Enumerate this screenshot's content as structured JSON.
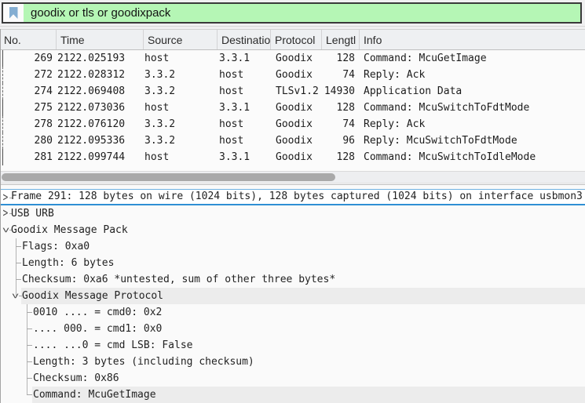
{
  "filter_bar": {
    "value": "goodix or tls or goodixpack",
    "background_color": "#b5f6b5",
    "bookmark_icon_color": "#84aed2"
  },
  "packet_list": {
    "columns": [
      "No.",
      "Time",
      "Source",
      "Destination",
      "Protocol",
      "Lengtl",
      "Info"
    ],
    "rows": [
      {
        "no": "269",
        "time": "2122.025193",
        "source": "host",
        "destination": "3.3.1",
        "protocol": "Goodix",
        "length": "128",
        "info": "Command: McuGetImage",
        "marker": "solid"
      },
      {
        "no": "272",
        "time": "2122.028312",
        "source": "3.3.2",
        "destination": "host",
        "protocol": "Goodix",
        "length": "74",
        "info": "Reply: Ack",
        "marker": "dashed"
      },
      {
        "no": "274",
        "time": "2122.069408",
        "source": "3.3.2",
        "destination": "host",
        "protocol": "TLSv1.2",
        "length": "14930",
        "info": "Application Data",
        "marker": "dashed"
      },
      {
        "no": "275",
        "time": "2122.073036",
        "source": "host",
        "destination": "3.3.1",
        "protocol": "Goodix",
        "length": "128",
        "info": "Command: McuSwitchToFdtMode",
        "marker": "solid"
      },
      {
        "no": "278",
        "time": "2122.076120",
        "source": "3.3.2",
        "destination": "host",
        "protocol": "Goodix",
        "length": "74",
        "info": "Reply: Ack",
        "marker": "dashed"
      },
      {
        "no": "280",
        "time": "2122.095336",
        "source": "3.3.2",
        "destination": "host",
        "protocol": "Goodix",
        "length": "96",
        "info": "Reply: McuSwitchToFdtMode",
        "marker": "dashed"
      },
      {
        "no": "281",
        "time": "2122.099744",
        "source": "host",
        "destination": "3.3.1",
        "protocol": "Goodix",
        "length": "128",
        "info": "Command: McuSwitchToIdleMode",
        "marker": "solid"
      }
    ]
  },
  "hscrollbar": {
    "orientation": "horizontal",
    "thumb_color": "#a9a9a9"
  },
  "packet_details": {
    "selected_border_color": "#2f8fd4",
    "shaded_row_color": "#ececec",
    "rows": [
      {
        "text": "Frame 291: 128 bytes on wire (1024 bits), 128 bytes captured (1024 bits) on interface usbmon3",
        "depth": 0,
        "expander": "collapsed",
        "selected": true
      },
      {
        "text": "USB URB",
        "depth": 0,
        "expander": "collapsed"
      },
      {
        "text": "Goodix Message Pack",
        "depth": 0,
        "expander": "expanded"
      },
      {
        "text": "Flags: 0xa0",
        "depth": 1
      },
      {
        "text": "Length: 6 bytes",
        "depth": 1
      },
      {
        "text": "Checksum: 0xa6 *untested, sum of other three bytes*",
        "depth": 1
      },
      {
        "text": "Goodix Message Protocol",
        "depth": 1,
        "expander": "expanded",
        "shaded": true
      },
      {
        "text": "0010 .... = cmd0: 0x2",
        "depth": 2
      },
      {
        "text": ".... 000. = cmd1: 0x0",
        "depth": 2
      },
      {
        "text": ".... ...0 = cmd LSB: False",
        "depth": 2
      },
      {
        "text": "Length: 3 bytes (including checksum)",
        "depth": 2
      },
      {
        "text": "Checksum: 0x86",
        "depth": 2
      },
      {
        "text": "Command: McuGetImage",
        "depth": 2,
        "shaded": true
      }
    ]
  }
}
